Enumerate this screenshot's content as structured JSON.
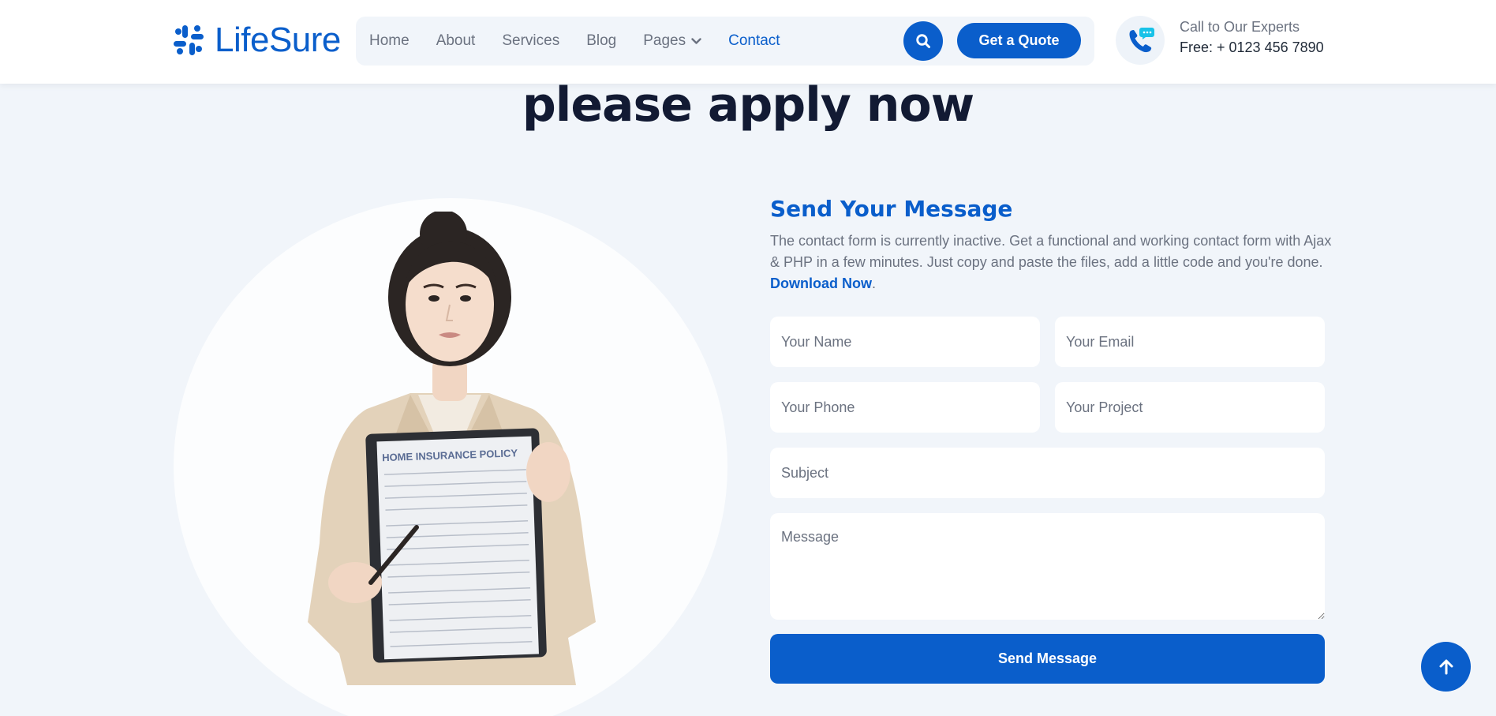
{
  "brand": {
    "name": "LifeSure",
    "color": "#0a5ecb"
  },
  "nav": {
    "items": [
      {
        "label": "Home",
        "active": false
      },
      {
        "label": "About",
        "active": false
      },
      {
        "label": "Services",
        "active": false
      },
      {
        "label": "Blog",
        "active": false
      },
      {
        "label": "Pages",
        "active": false,
        "dropdown": true
      },
      {
        "label": "Contact",
        "active": true
      }
    ],
    "search_icon": "search-icon",
    "quote_label": "Get a Quote"
  },
  "contact": {
    "icon": "phone-chat-icon",
    "label": "Call to Our Experts",
    "number": "Free: + 0123 456 7890"
  },
  "hero": {
    "heading": "please apply now"
  },
  "illustration": {
    "document_title": "HOME INSURANCE POLICY"
  },
  "form": {
    "title": "Send Your Message",
    "description": "The contact form is currently inactive. Get a functional and working contact form with Ajax & PHP in a few minutes. Just copy and paste the files, add a little code and you're done. ",
    "download_label": "Download Now",
    "description_end": ".",
    "fields": {
      "name": {
        "placeholder": "Your Name",
        "value": ""
      },
      "email": {
        "placeholder": "Your Email",
        "value": ""
      },
      "phone": {
        "placeholder": "Your Phone",
        "value": ""
      },
      "project": {
        "placeholder": "Your Project",
        "value": ""
      },
      "subject": {
        "placeholder": "Subject",
        "value": ""
      },
      "message": {
        "placeholder": "Message",
        "value": ""
      }
    },
    "submit_label": "Send Message"
  },
  "back_to_top_icon": "arrow-up-icon"
}
